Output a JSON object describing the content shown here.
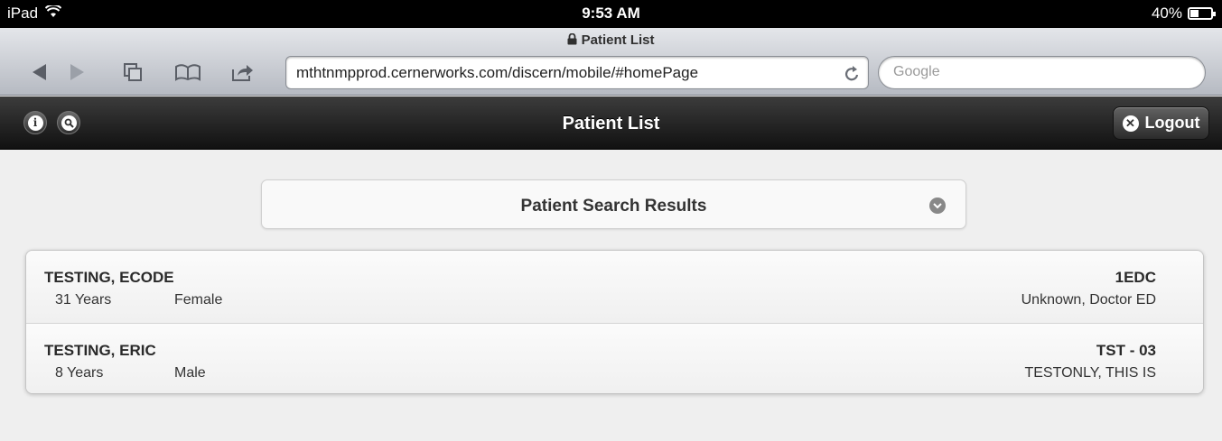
{
  "status_bar": {
    "device": "iPad",
    "time": "9:53 AM",
    "battery_percent": "40%",
    "battery_level": 0.4
  },
  "browser": {
    "page_title": "Patient List",
    "url": "mthtnmpprod.cernerworks.com/discern/mobile/#homePage",
    "search_placeholder": "Google",
    "icons": [
      "back-icon",
      "forward-icon",
      "pages-icon",
      "bookmarks-icon",
      "share-icon",
      "reload-icon",
      "lock-icon"
    ]
  },
  "app_header": {
    "title": "Patient List",
    "logout_label": "Logout",
    "info_icon": "i",
    "search_icon": "search-icon"
  },
  "search_results": {
    "label": "Patient Search Results"
  },
  "patients": [
    {
      "name": "TESTING, ECODE",
      "age": "31 Years",
      "sex": "Female",
      "location": "1EDC",
      "provider": "Unknown, Doctor ED"
    },
    {
      "name": "TESTING, ERIC",
      "age": "8 Years",
      "sex": "Male",
      "location": "TST - 03",
      "provider": "TESTONLY, THIS IS"
    }
  ],
  "colors": {
    "header_dark": "#1a1a1a",
    "page_bg": "#efefef",
    "toolbar_top": "#e4e6ea",
    "toolbar_bottom": "#b6bac2"
  }
}
